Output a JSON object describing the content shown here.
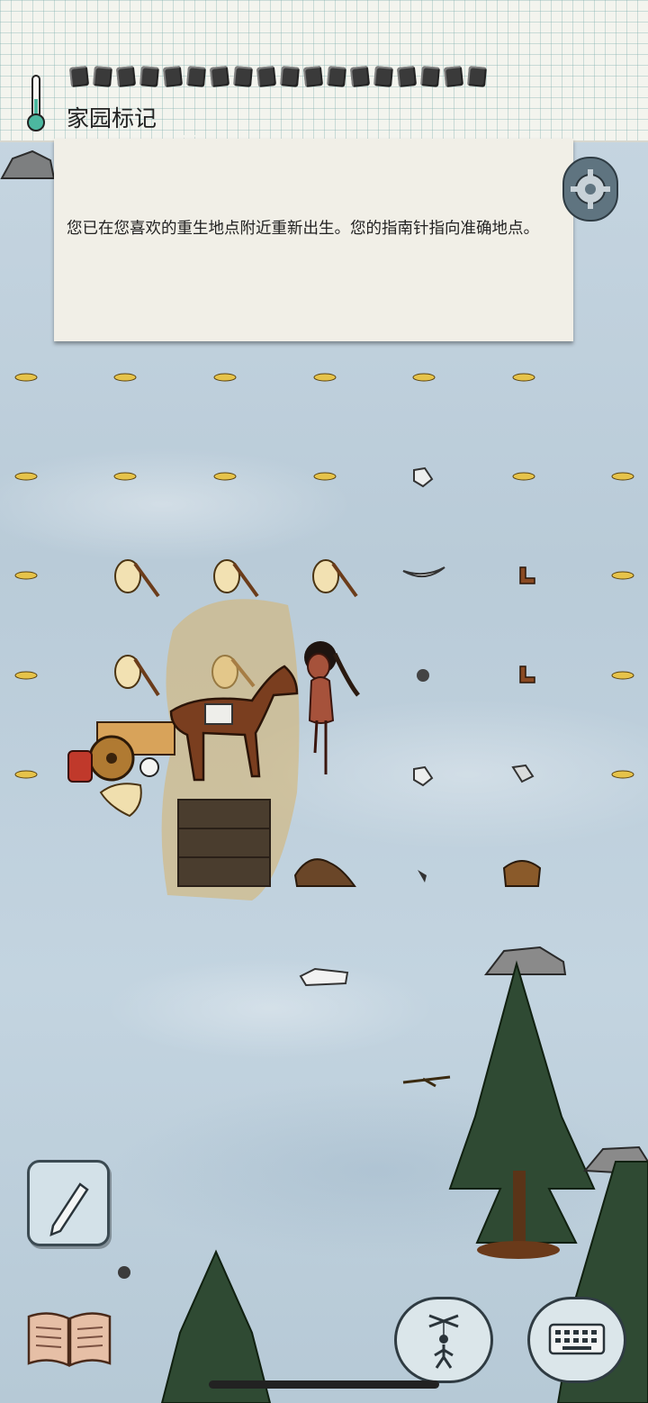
{
  "header": {
    "title": "家园标记",
    "food_pips": 18
  },
  "message": {
    "text": "您已在您喜欢的重生地点附近重新出生。您的指南针指向准确地点。"
  },
  "icons": {
    "thermometer": "thermometer-icon",
    "settings": "gear-icon",
    "pencil": "pencil-icon",
    "book": "book-icon",
    "puppet": "puppet-icon",
    "keyboard": "keyboard-icon"
  },
  "colors": {
    "snow": "#c3d4e0",
    "paper": "#f1efe7",
    "grid": "#78aaaa",
    "seed": "#e6c34a",
    "pine": "#2f4a33",
    "horse": "#7a3e1f",
    "cart": "#d8a35a"
  }
}
